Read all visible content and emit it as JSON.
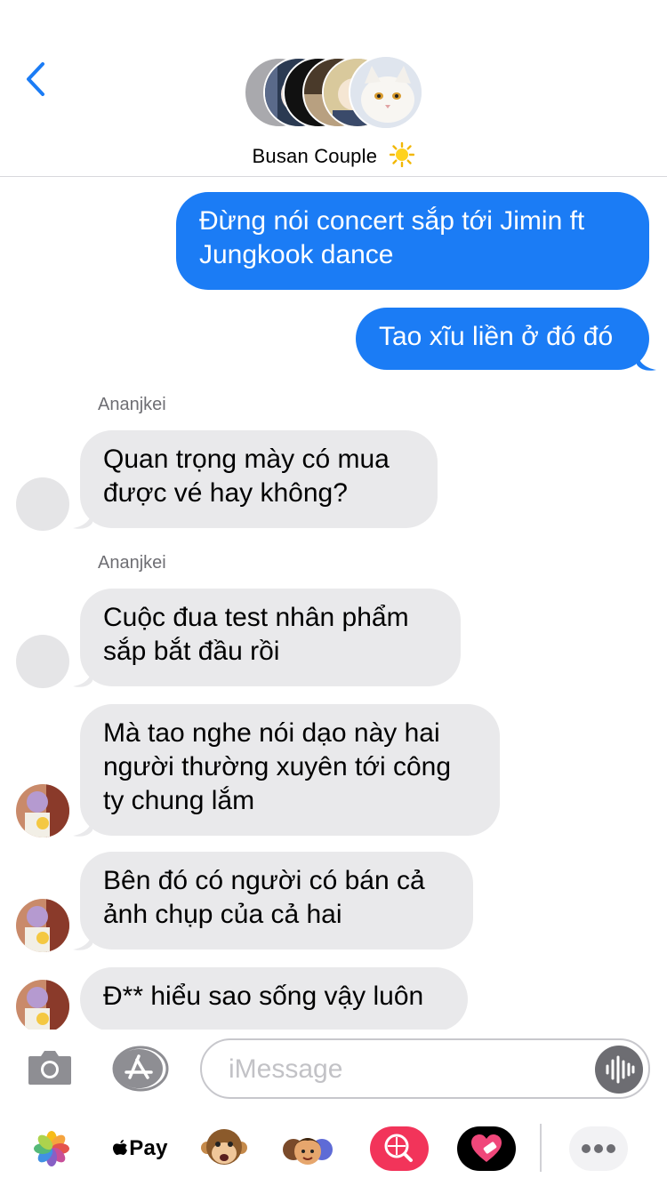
{
  "header": {
    "back_label": "Back",
    "group_name": "Busan Couple"
  },
  "messages": [
    {
      "type": "sent",
      "text": "Đừng nói concert sắp tới Jimin ft Jungkook dance"
    },
    {
      "type": "sent",
      "text": "Tao xĩu liền ở đó đó"
    },
    {
      "type": "recv",
      "sender": "Ananjkei",
      "text": "Quan trọng mày có mua được vé hay không?"
    },
    {
      "type": "recv",
      "sender": "Ananjkei",
      "text": "Cuộc đua test nhân phẩm sắp bắt đầu rồi"
    },
    {
      "type": "recv",
      "text": "Mà tao nghe nói dạo này hai người thường xuyên tới công ty chung lắm"
    },
    {
      "type": "recv",
      "text": "Bên đó có người có bán cả ảnh chụp của cả hai"
    },
    {
      "type": "recv",
      "text": "Đ** hiểu sao sống vậy luôn"
    }
  ],
  "composer": {
    "placeholder": "iMessage"
  },
  "drawer": {
    "apple_pay_label": "Pay",
    "apps": [
      "photos-icon",
      "apple-pay-icon",
      "monkey-animoji-icon",
      "memoji-icon",
      "image-search-icon",
      "heart-app-icon",
      "more-icon"
    ]
  },
  "colors": {
    "sent_bubble": "#1b7cf5",
    "recv_bubble": "#e9e9eb",
    "accent": "#1b7cf5"
  }
}
